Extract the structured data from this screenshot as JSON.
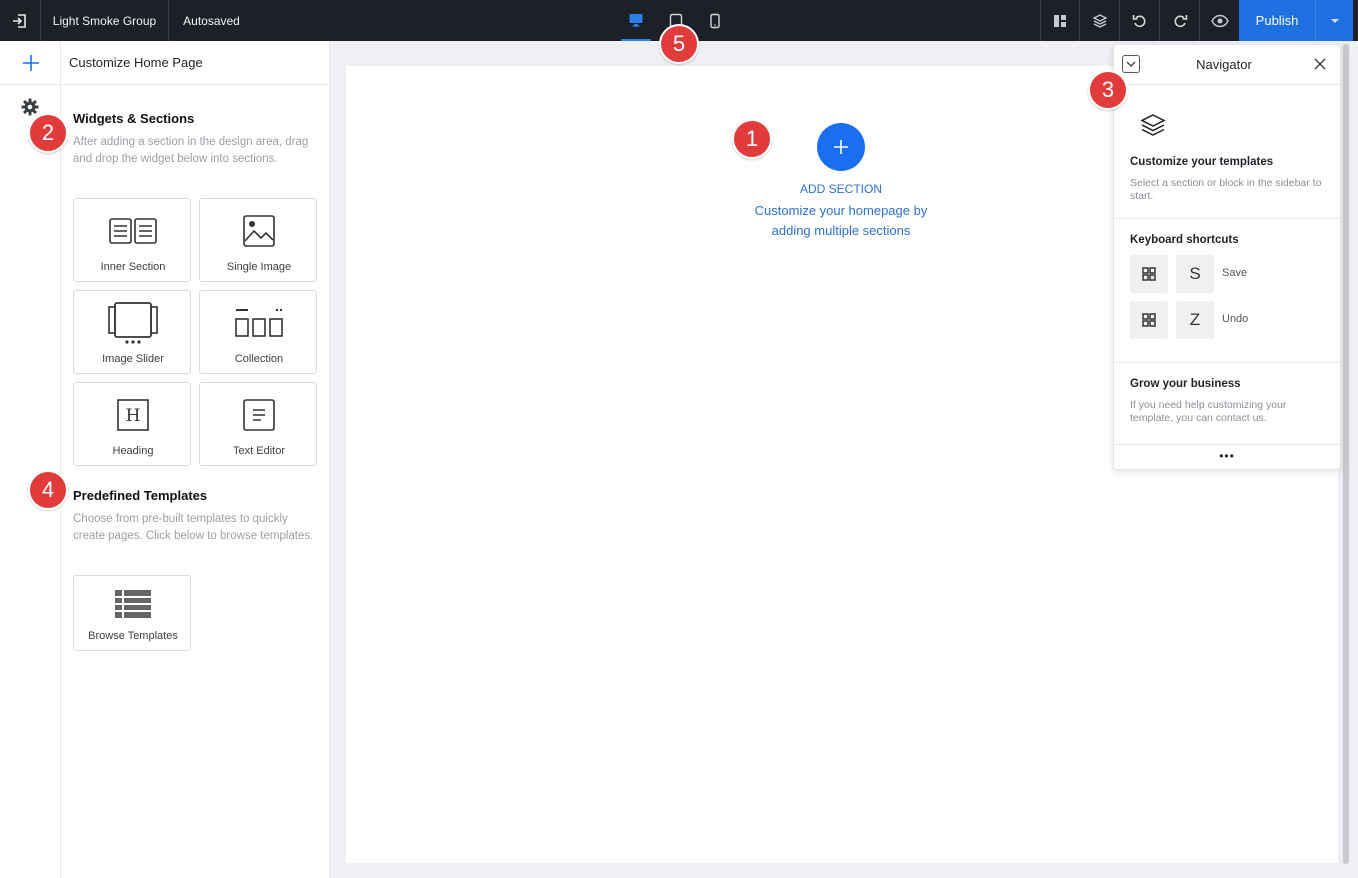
{
  "topbar": {
    "site_name": "Light Smoke Group",
    "status": "Autosaved",
    "publish_label": "Publish",
    "devices": [
      "desktop",
      "tablet",
      "mobile"
    ],
    "active_device": "desktop",
    "icons": [
      "exit-icon",
      "layout-icon",
      "layers-icon",
      "undo-icon",
      "redo-icon",
      "preview-eye-icon",
      "chevron-down-icon"
    ]
  },
  "rail": {
    "icons": [
      "plus-icon",
      "gear-icon"
    ]
  },
  "panel": {
    "title": "Customize Home Page",
    "widgets": {
      "title": "Widgets & Sections",
      "description": "After adding a section in the design area, drag and drop the widget below into sections.",
      "items": [
        {
          "label": "Inner Section",
          "icon": "inner-section-icon"
        },
        {
          "label": "Single Image",
          "icon": "image-icon"
        },
        {
          "label": "Image Slider",
          "icon": "slider-icon"
        },
        {
          "label": "Collection",
          "icon": "collection-icon"
        },
        {
          "label": "Heading",
          "icon": "heading-icon"
        },
        {
          "label": "Text Editor",
          "icon": "text-editor-icon"
        }
      ]
    },
    "templates": {
      "title": "Predefined Templates",
      "description": "Choose from pre-built templates to quickly create pages. Click below to browse templates.",
      "browse_label": "Browse Templates"
    }
  },
  "canvas": {
    "add_section_label": "ADD SECTION",
    "add_section_description": "Customize your homepage by adding multiple sections"
  },
  "navigator": {
    "title": "Navigator",
    "intro_title": "Customize your templates",
    "intro_description": "Select a section or block in the sidebar to start.",
    "shortcuts_title": "Keyboard shortcuts",
    "shortcuts": [
      {
        "key": "S",
        "label": "Save"
      },
      {
        "key": "Z",
        "label": "Undo"
      }
    ],
    "grow_title": "Grow your business",
    "grow_description": "If you need help customizing your template, you can contact us.",
    "more_label": "•••"
  },
  "badges": [
    "1",
    "2",
    "3",
    "4",
    "5"
  ],
  "colors": {
    "topbar_bg": "#1c2027",
    "accent": "#1e6fe0",
    "badge": "#e23b3b",
    "link": "#2b72d6"
  }
}
